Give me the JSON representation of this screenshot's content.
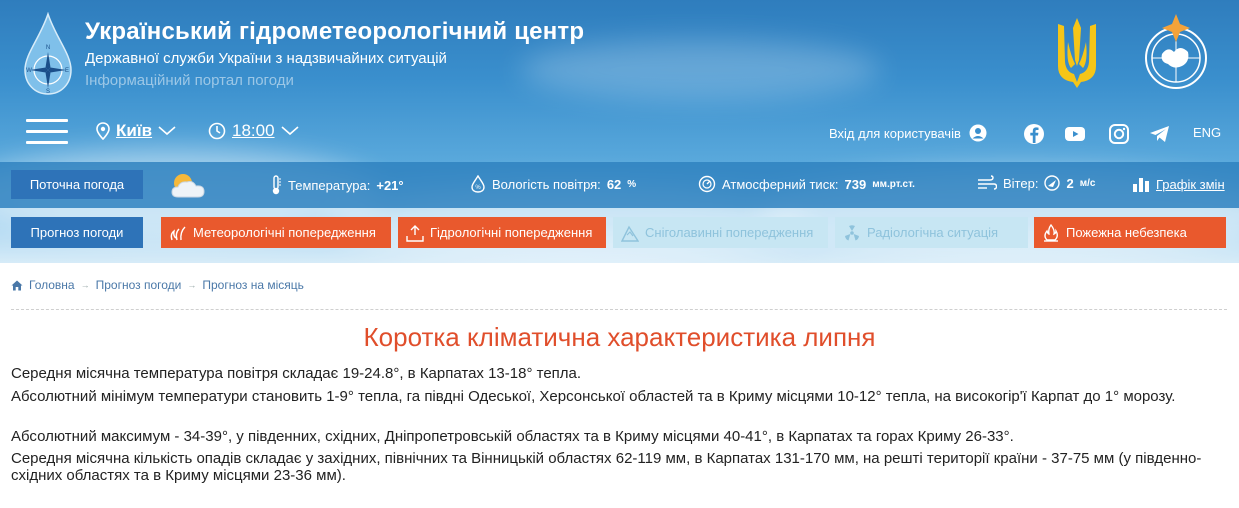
{
  "header": {
    "title": "Український гідрометеорологічний центр",
    "subtitle": "Державної служби України з надзвичайних ситуацій",
    "portal": "Інформаційний портал погоди",
    "logo_letters": {
      "n": "N",
      "e": "E",
      "s": "S",
      "w": "W"
    }
  },
  "nav": {
    "city": "Київ",
    "time": "18:00",
    "login": "Вхід для користувачів",
    "lang": "ENG",
    "social": [
      "facebook-icon",
      "youtube-icon",
      "instagram-icon",
      "telegram-icon"
    ]
  },
  "current": {
    "label": "Поточна погода",
    "temp_label": "Температура:",
    "temp_value": "+21°",
    "humidity_label": "Вологість повітря:",
    "humidity_value": "62",
    "humidity_unit": "%",
    "pressure_label": "Атмосферний тиск:",
    "pressure_value": "739",
    "pressure_unit": "мм.рт.ст.",
    "wind_label": "Вітер:",
    "wind_value": "2",
    "wind_unit": "м/с",
    "chart_link": "Графік змін"
  },
  "forecast": {
    "label": "Прогноз погоди",
    "warnings": [
      {
        "label": "Метеорологічні попередження",
        "color": "#e9592d"
      },
      {
        "label": "Гідрологічні попередження",
        "color": "#e9592d"
      },
      {
        "label": "Сніголавинні попередження",
        "color": "#c7e6f3"
      },
      {
        "label": "Радіологічна ситуація",
        "color": "#c7e6f3"
      },
      {
        "label": "Пожежна небезпека",
        "color": "#e9592d"
      }
    ]
  },
  "breadcrumb": [
    "Головна",
    "Прогноз погоди",
    "Прогноз на місяць"
  ],
  "content": {
    "title": "Коротка кліматична характеристика липня",
    "paragraphs": [
      "Середня місячна температура повітря складає 19-24.8°, в Карпатах 13-18° тепла.",
      "Абсолютний мінімум температури становить 1-9° тепла, га півдні Одеської, Херсонської областей та в Криму місцями 10-12° тепла, на високогір'ї Карпат до 1° морозу.",
      "Абсолютний максимум - 34-39°, у південних, східних, Дніпропетровській областях та в Криму місцями 40-41°, в Карпатах та горах Криму 26-33°.",
      "Середня місячна кількість опадів складає у західних, північних та Вінницькій областях 62-119 мм, в Карпатах 131-170 мм, на решті території країни - 37-75 мм (у південно-східних областях та в Криму місцями 23-36 мм)."
    ]
  },
  "colors": {
    "accent": "#e04e2b",
    "blue_button": "#2e73b8",
    "warning_red": "#e9592d"
  }
}
